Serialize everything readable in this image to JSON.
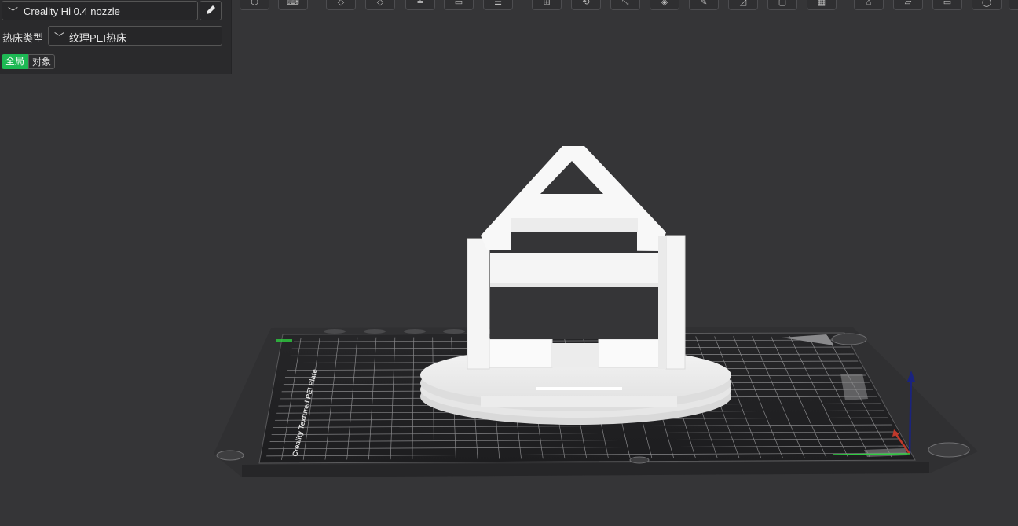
{
  "printer": {
    "name": "Creality Hi 0.4 nozzle",
    "dropdown_icon": "chevron-down-icon",
    "edit_icon": "pencil-icon"
  },
  "bed": {
    "label": "热床类型",
    "value": "纹理PEI热床",
    "dropdown_icon": "chevron-down-icon"
  },
  "scope_tabs": {
    "global": "全局",
    "object": "对象",
    "active": "global",
    "active_color": "#1db954"
  },
  "toolbar": {
    "tools": [
      {
        "name": "add-object-icon",
        "glyph": "⬡"
      },
      {
        "name": "keyboard-icon",
        "glyph": "⌨"
      },
      {
        "name": "orient-icon",
        "glyph": "◇"
      },
      {
        "name": "layflat-icon",
        "glyph": "◇"
      },
      {
        "name": "arrange-icon",
        "glyph": "≚"
      },
      {
        "name": "split-icon",
        "glyph": "▭"
      },
      {
        "name": "layer-icon",
        "glyph": "☰"
      },
      {
        "name": "move-icon",
        "glyph": "⊞"
      },
      {
        "name": "rotate-icon",
        "glyph": "⟲"
      },
      {
        "name": "scale-icon",
        "glyph": "⤡"
      },
      {
        "name": "cut-icon",
        "glyph": "◈"
      },
      {
        "name": "support-paint-icon",
        "glyph": "✎"
      },
      {
        "name": "seam-paint-icon",
        "glyph": "◿"
      },
      {
        "name": "measure-icon",
        "glyph": "▢"
      },
      {
        "name": "text-icon",
        "glyph": "▦"
      },
      {
        "name": "assembly-icon",
        "glyph": "⌂"
      },
      {
        "name": "hollow-icon",
        "glyph": "▱"
      },
      {
        "name": "emboss-icon",
        "glyph": "▭"
      },
      {
        "name": "view-icon",
        "glyph": "◯"
      },
      {
        "name": "more-icon",
        "glyph": "▢"
      }
    ]
  },
  "scene": {
    "plate_brand_text": "Creality Textured PEI Plate",
    "model_color": "#ffffff",
    "axis_colors": {
      "x": "#c0392b",
      "y": "#2ecc40",
      "z": "#1a237e"
    }
  }
}
